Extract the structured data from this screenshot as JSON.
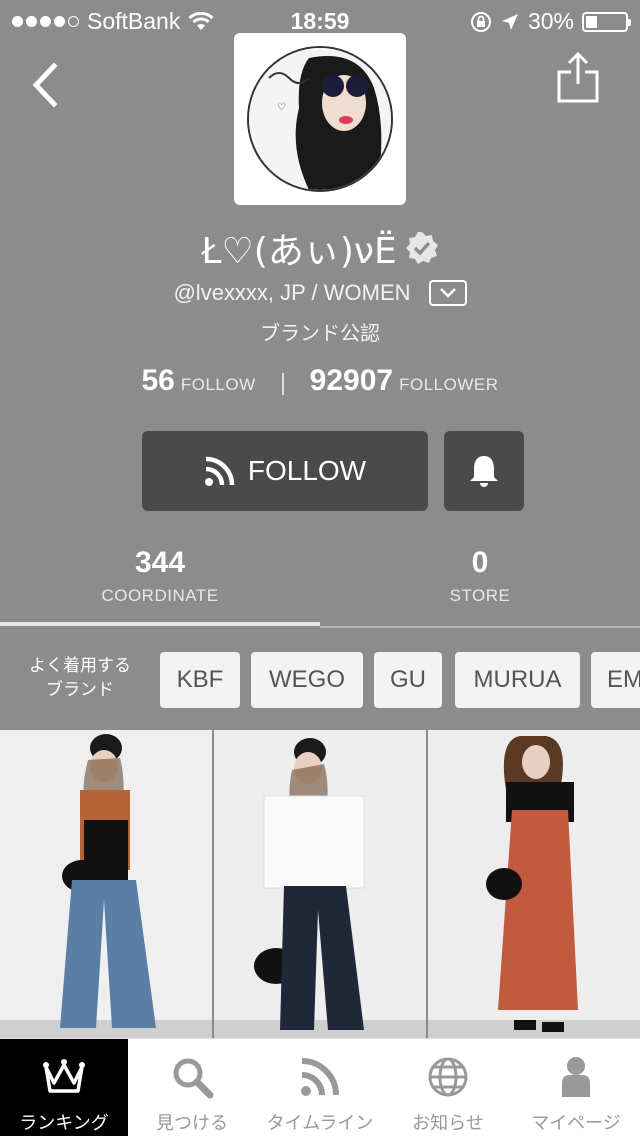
{
  "status_bar": {
    "carrier": "SoftBank",
    "time": "18:59",
    "battery": "30%",
    "battery_level": 0.3
  },
  "profile": {
    "name": "Ł♡(あぃ)νË",
    "handle": "@lvexxxx, JP / WOMEN",
    "badge": "ブランド公認",
    "follow_count": "56",
    "follow_label": "FOLLOW",
    "follower_count": "92907",
    "follower_label": "FOLLOWER"
  },
  "actions": {
    "follow_label": "FOLLOW"
  },
  "tabs": [
    {
      "count": "344",
      "label": "COORDINATE"
    },
    {
      "count": "0",
      "label": "STORE"
    }
  ],
  "brands": {
    "caption": "よく着用する\nブランド",
    "items": [
      "KBF",
      "WEGO",
      "GU",
      "MURUA",
      "EM"
    ]
  },
  "tabbar": [
    {
      "label": "ランキング",
      "icon": "crown-icon",
      "active": true
    },
    {
      "label": "見つける",
      "icon": "search-icon"
    },
    {
      "label": "タイムライン",
      "icon": "rss-icon"
    },
    {
      "label": "お知らせ",
      "icon": "globe-icon"
    },
    {
      "label": "マイページ",
      "icon": "person-icon"
    }
  ],
  "colors": {
    "background": "#8c8c8c",
    "button": "#4a4a4a",
    "chip": "#f3f3f3",
    "active_tab": "#000000"
  }
}
